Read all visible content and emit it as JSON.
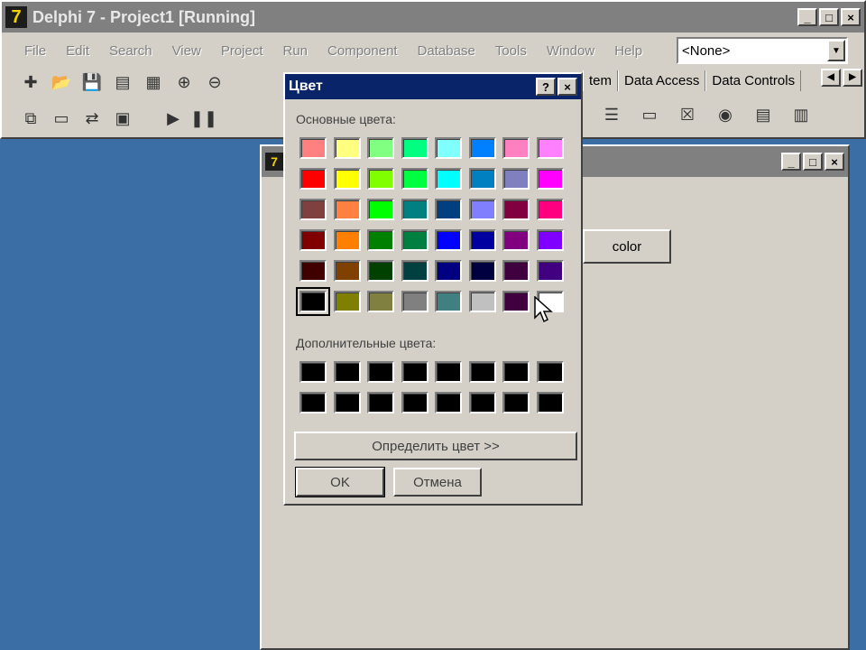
{
  "ide": {
    "title": "Delphi 7 - Project1 [Running]",
    "logo": "7",
    "menu": [
      "File",
      "Edit",
      "Search",
      "View",
      "Project",
      "Run",
      "Component",
      "Database",
      "Tools",
      "Window",
      "Help"
    ],
    "combo_value": "<None>",
    "palette_tabs": [
      "tem",
      "Data Access",
      "Data Controls"
    ],
    "window_buttons": [
      "_",
      "□",
      "×"
    ]
  },
  "form": {
    "window_buttons": [
      "_",
      "□",
      "×"
    ],
    "button_label": "color"
  },
  "dialog": {
    "title": "Цвет",
    "help_button": "?",
    "close_button": "×",
    "basic_colors_label": "Основные цвета:",
    "custom_colors_label": "Дополнительные цвета:",
    "define_button": "Определить цвет >>",
    "ok_button": "OK",
    "cancel_button": "Отмена",
    "basic_colors": [
      "#ff8080",
      "#ffff80",
      "#80ff80",
      "#00ff80",
      "#80ffff",
      "#0080ff",
      "#ff80c0",
      "#ff80ff",
      "#ff0000",
      "#ffff00",
      "#80ff00",
      "#00ff40",
      "#00ffff",
      "#0080c0",
      "#8080c0",
      "#ff00ff",
      "#804040",
      "#ff8040",
      "#00ff00",
      "#008080",
      "#004080",
      "#8080ff",
      "#800040",
      "#ff0080",
      "#800000",
      "#ff8000",
      "#008000",
      "#008040",
      "#0000ff",
      "#0000a0",
      "#800080",
      "#8000ff",
      "#400000",
      "#804000",
      "#004000",
      "#004040",
      "#000080",
      "#000040",
      "#400040",
      "#400080",
      "#000000",
      "#808000",
      "#808040",
      "#808080",
      "#408080",
      "#c0c0c0",
      "#400040",
      "#ffffff"
    ],
    "selected_index": 40,
    "custom_colors": [
      "#000000",
      "#000000",
      "#000000",
      "#000000",
      "#000000",
      "#000000",
      "#000000",
      "#000000",
      "#000000",
      "#000000",
      "#000000",
      "#000000",
      "#000000",
      "#000000",
      "#000000",
      "#000000"
    ]
  }
}
